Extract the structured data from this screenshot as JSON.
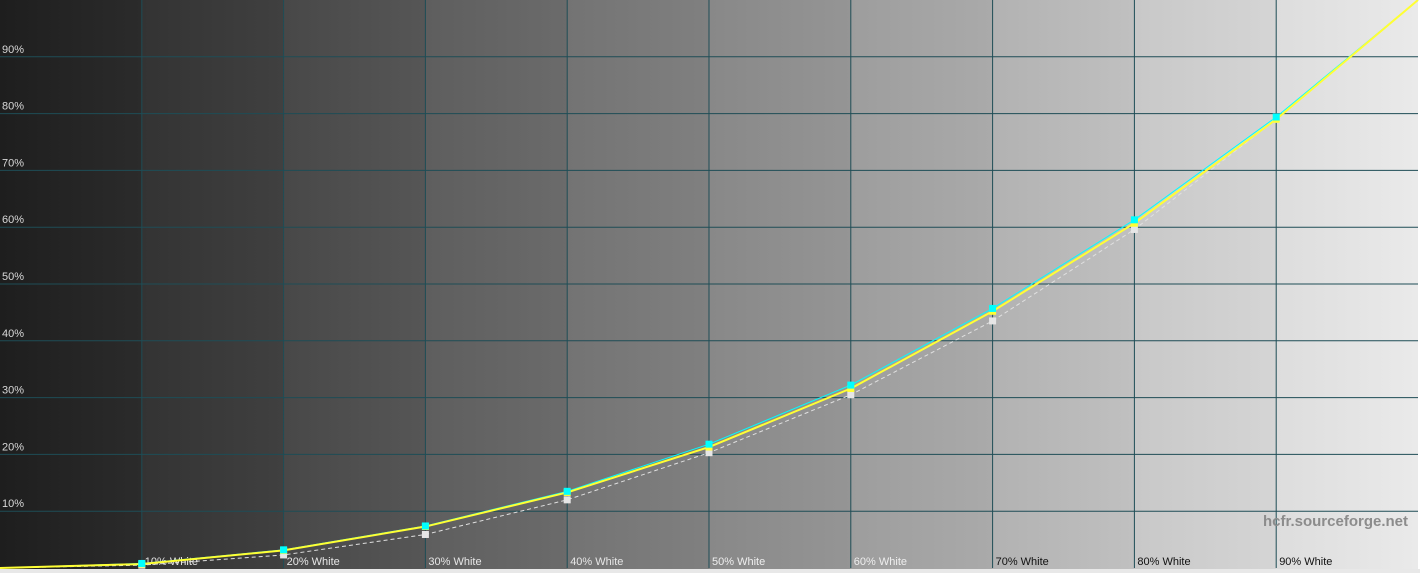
{
  "chart_data": {
    "type": "line",
    "title": "",
    "xlabel": "",
    "ylabel": "",
    "x": [
      0,
      10,
      20,
      30,
      40,
      50,
      60,
      70,
      80,
      90,
      100
    ],
    "x_tick_labels": [
      "",
      "10% White",
      "20% White",
      "30% White",
      "40% White",
      "50% White",
      "60% White",
      "70% White",
      "80% White",
      "90% White",
      ""
    ],
    "y_tick_labels": [
      "10%",
      "20%",
      "30%",
      "40%",
      "50%",
      "60%",
      "70%",
      "80%",
      "90%"
    ],
    "y_ticks": [
      10,
      20,
      30,
      40,
      50,
      60,
      70,
      80,
      90
    ],
    "xlim": [
      0,
      100
    ],
    "ylim": [
      0,
      100
    ],
    "grid": true,
    "background": "grayscale gradient steps from black to white",
    "series": [
      {
        "color": "#ffff33",
        "style": "solid",
        "values": [
          0.0,
          0.7,
          3.1,
          7.3,
          13.3,
          21.3,
          31.6,
          45.2,
          60.7,
          79.0,
          100.0
        ]
      },
      {
        "color": "#00ffff",
        "style": "markers",
        "values": [
          0.0,
          0.8,
          3.2,
          7.4,
          13.5,
          21.8,
          32.2,
          45.7,
          61.3,
          79.4,
          100.0
        ]
      },
      {
        "color": "#e0e0e0",
        "style": "dashed",
        "values": [
          0.0,
          0.5,
          2.3,
          5.9,
          12.0,
          20.3,
          30.5,
          43.5,
          59.6,
          79.0,
          100.0
        ]
      }
    ],
    "watermark": "hcfr.sourceforge.net"
  }
}
